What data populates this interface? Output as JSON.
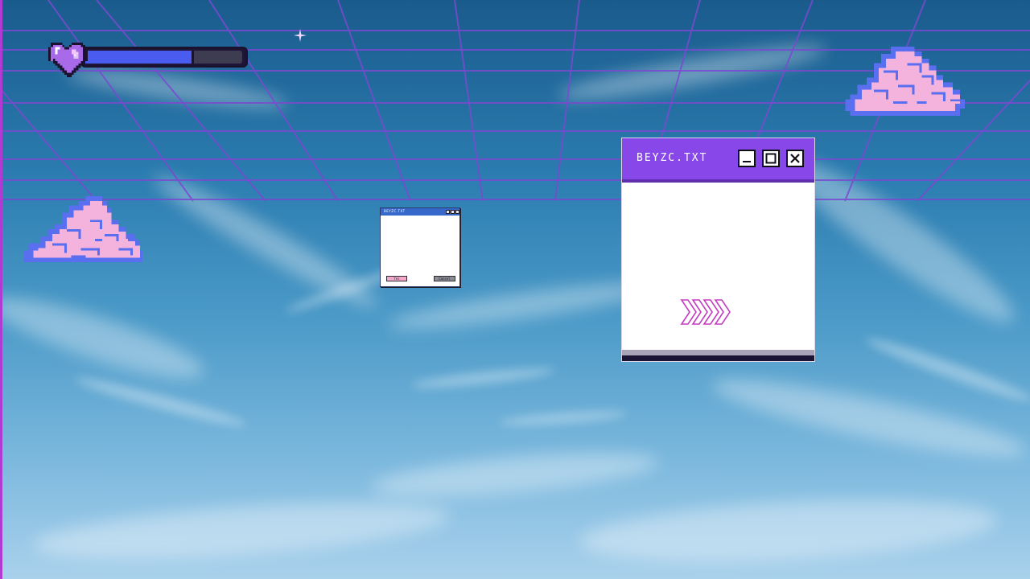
{
  "scene": {
    "colors": {
      "grid_line": "#7a4ad0",
      "cloud_pink": "#f3b3dd",
      "cloud_blue": "#5a6ef0",
      "window_purple": "#8847e8"
    }
  },
  "health_bar": {
    "icon": "heart-icon",
    "level": 0.66,
    "fill_color": "#4a5cf0"
  },
  "main_window": {
    "title": "BEYZC.TXT",
    "controls": [
      "minimize-icon",
      "maximize-icon",
      "close-icon"
    ],
    "arrows_icon": "chevron-right-icon"
  },
  "mini_window": {
    "title": "BEYZC.TXT",
    "yes_label": "Yes",
    "cancel_label": "Cancel"
  }
}
